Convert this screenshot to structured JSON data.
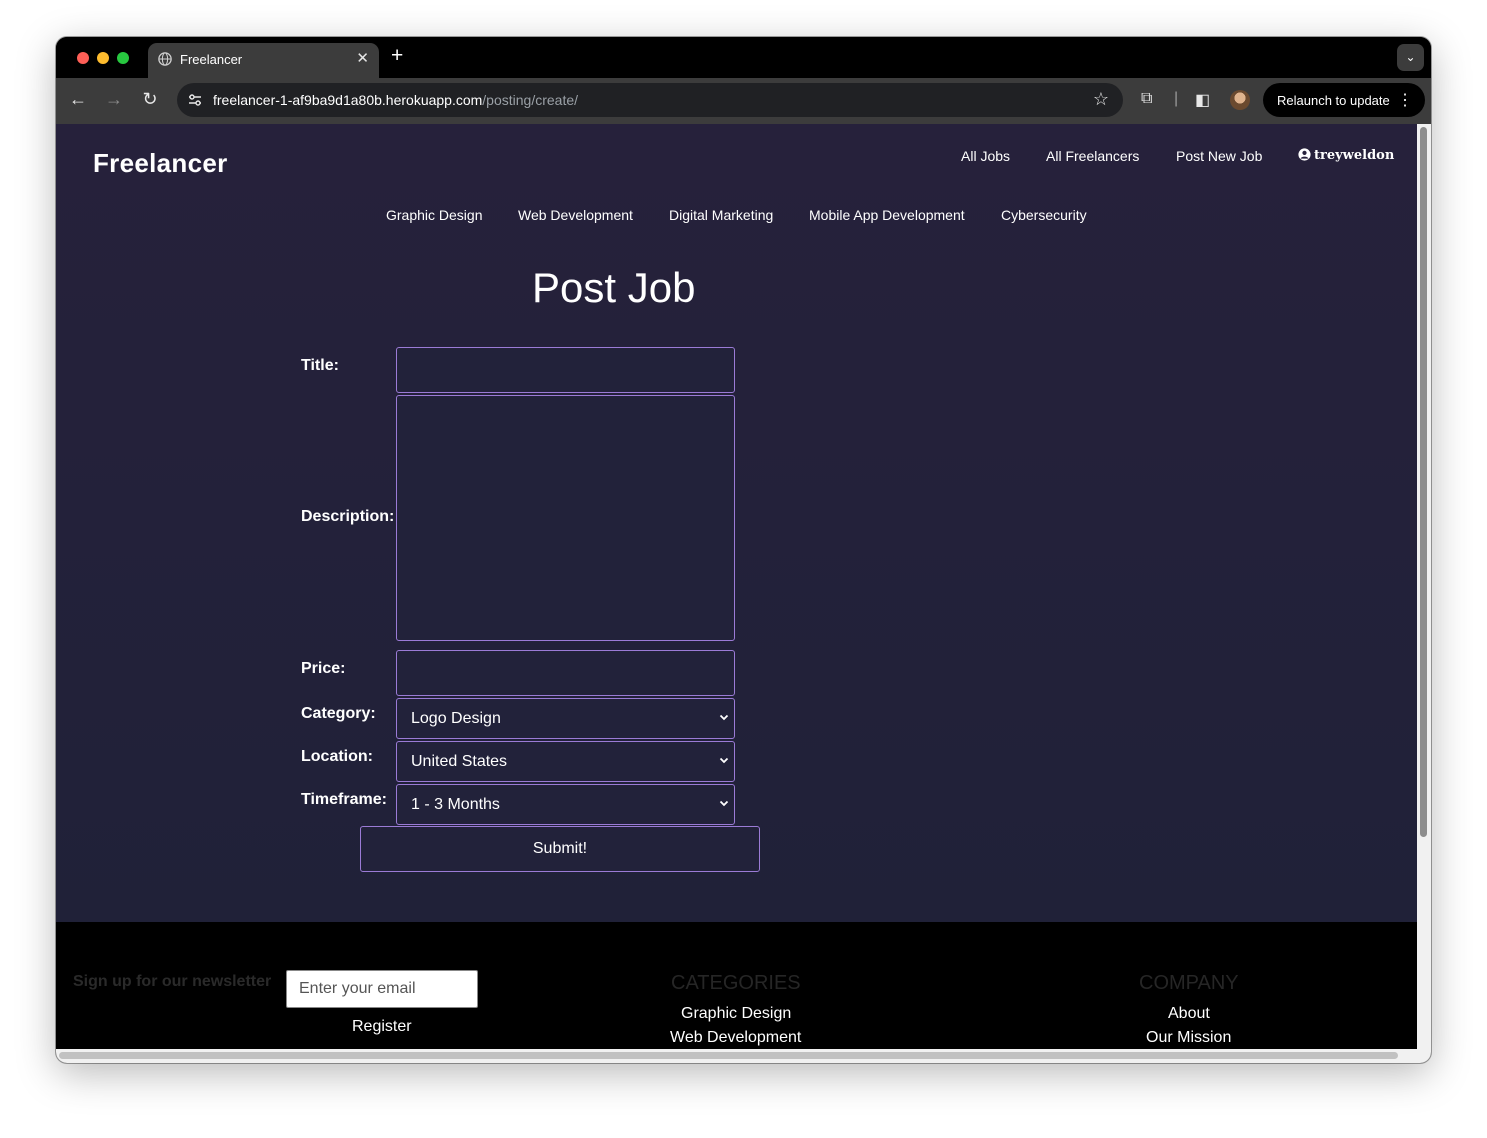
{
  "browser": {
    "tab_title": "Freelancer",
    "tab_close": "✕",
    "new_tab": "+",
    "url_host": "freelancer-1-af9ba9d1a80b.herokuapp.com",
    "url_path": "/posting/create/",
    "relaunch_label": "Relaunch to update"
  },
  "site": {
    "brand": "Freelancer",
    "nav": [
      "All Jobs",
      "All Freelancers",
      "Post New Job"
    ],
    "user": "treyweldon",
    "categories": [
      "Graphic Design",
      "Web Development",
      "Digital Marketing",
      "Mobile App Development",
      "Cybersecurity"
    ]
  },
  "form": {
    "heading": "Post Job",
    "title_label": "Title:",
    "title_value": "",
    "description_label": "Description:",
    "description_value": "",
    "price_label": "Price:",
    "price_value": "",
    "category_label": "Category:",
    "category_value": "Logo Design",
    "location_label": "Location:",
    "location_value": "United States",
    "timeframe_label": "Timeframe:",
    "timeframe_value": "1 - 3 Months",
    "submit_label": "Submit!"
  },
  "footer": {
    "newsletter_label": "Sign up for our newsletter",
    "email_placeholder": "Enter your email",
    "register_label": "Register",
    "categories_heading": "CATEGORIES",
    "categories_links": [
      "Graphic Design",
      "Web Development"
    ],
    "company_heading": "COMPANY",
    "company_links": [
      "About",
      "Our Mission"
    ]
  },
  "colors": {
    "page_bg": "#26213b",
    "field_border": "#9b7bd6",
    "field_bg": "#22223a",
    "footer_bg": "#000000"
  }
}
